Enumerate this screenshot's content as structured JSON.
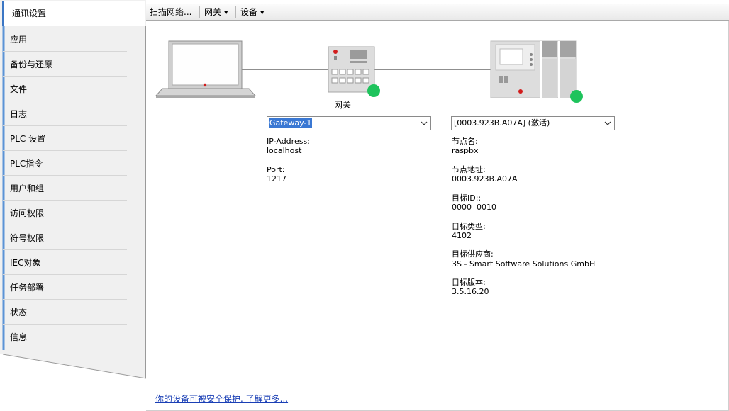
{
  "sidebar": {
    "items": [
      {
        "label": "通讯设置",
        "active": true
      },
      {
        "label": "应用"
      },
      {
        "label": "备份与还原"
      },
      {
        "label": "文件"
      },
      {
        "label": "日志"
      },
      {
        "label": "PLC 设置"
      },
      {
        "label": "PLC指令"
      },
      {
        "label": "用户和组"
      },
      {
        "label": "访问权限"
      },
      {
        "label": "符号权限"
      },
      {
        "label": "IEC对象"
      },
      {
        "label": "任务部署"
      },
      {
        "label": "状态"
      },
      {
        "label": "信息"
      }
    ]
  },
  "toolbar": {
    "scan_label": "扫描网络...",
    "gateway_label": "网关",
    "device_label": "设备",
    "dropdown_icon": "triangle-down-icon"
  },
  "topology": {
    "computer_icon": "laptop-icon",
    "gateway_icon": "gateway-device-icon",
    "plc_icon": "plc-device-icon",
    "gateway_caption": "网关",
    "status_color": "#1ec35c"
  },
  "gateway_panel": {
    "selected": "Gateway-1",
    "ip_label": "IP-Address:",
    "ip_value": "localhost",
    "port_label": "Port:",
    "port_value": "1217"
  },
  "device_panel": {
    "selected": "[0003.923B.A07A] (激活)",
    "fields": [
      {
        "label": "节点名:",
        "value": "raspbx"
      },
      {
        "label": "节点地址:",
        "value": "0003.923B.A07A"
      },
      {
        "label": "目标ID::",
        "value": "0000  0010"
      },
      {
        "label": "目标类型:",
        "value": "4102"
      },
      {
        "label": "目标供应商:",
        "value": "3S - Smart Software Solutions GmbH"
      },
      {
        "label": "目标版本:",
        "value": "3.5.16.20"
      }
    ]
  },
  "footer": {
    "security_link": "你的设备可被安全保护. 了解更多..."
  },
  "colors": {
    "accent": "#3b76c4",
    "selection": "#3a78d3",
    "link": "#1a3fb5",
    "online": "#1ec35c"
  }
}
